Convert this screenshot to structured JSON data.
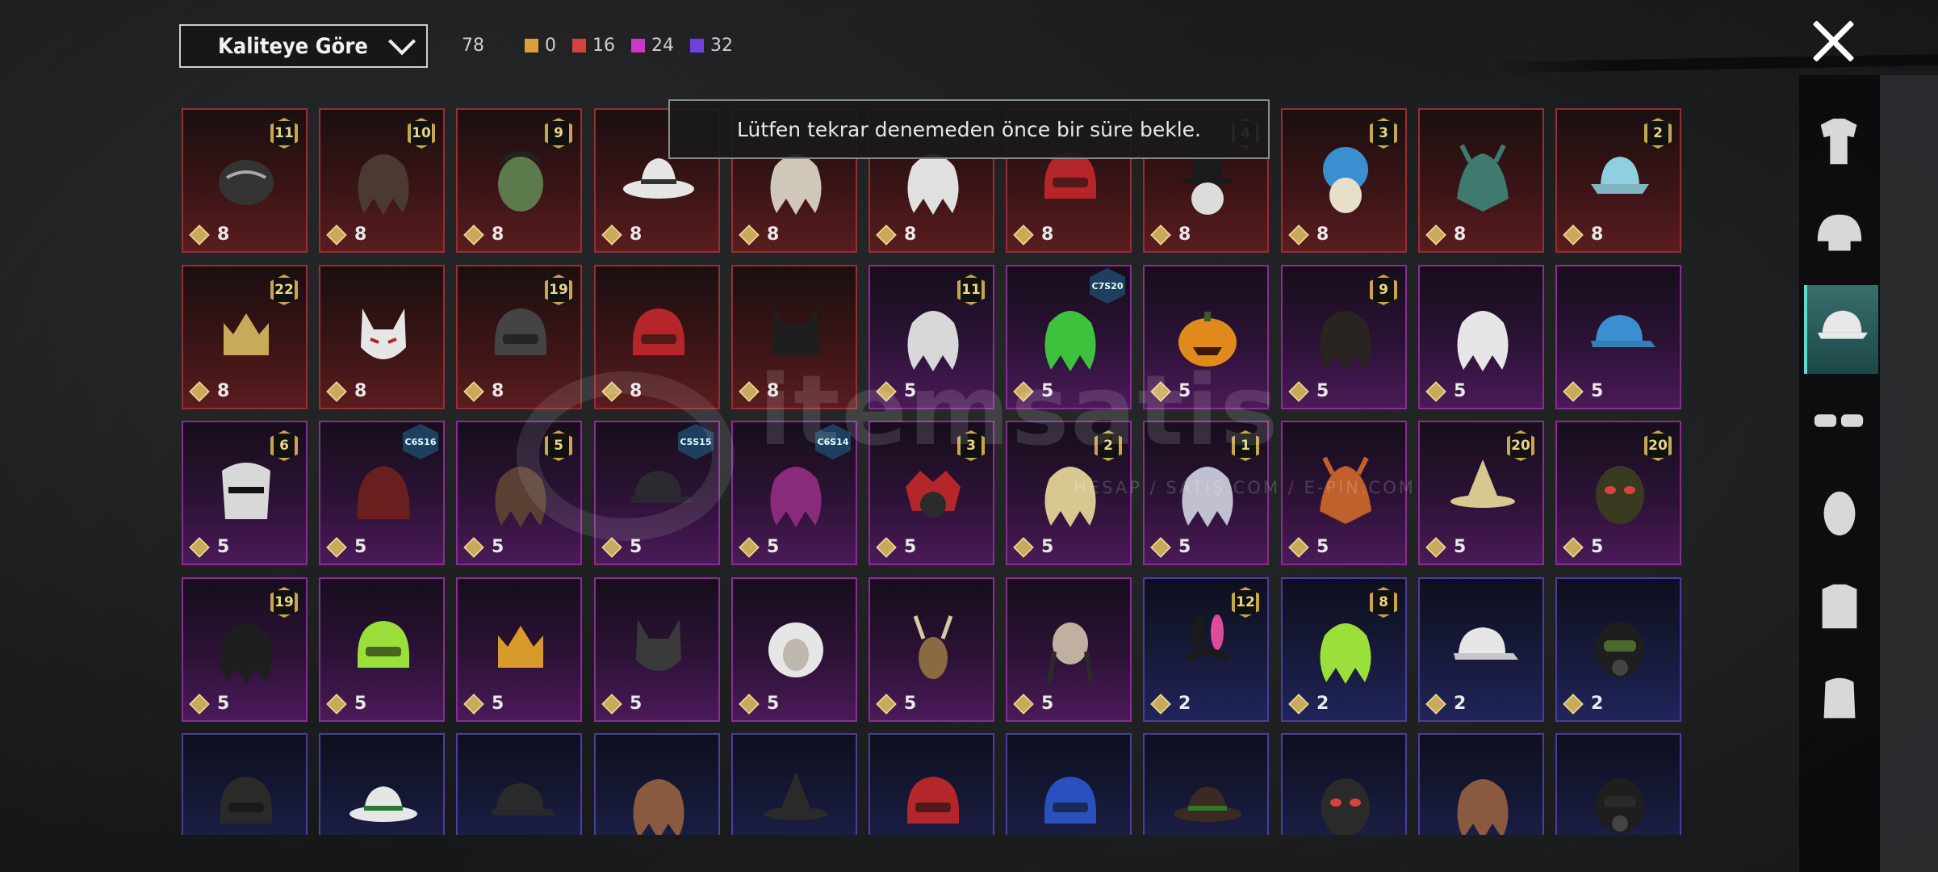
{
  "header": {
    "sort_label": "Kaliteye Göre",
    "total": "78",
    "counts": [
      {
        "color": "#d9a03b",
        "value": "0"
      },
      {
        "color": "#d6423e",
        "value": "16"
      },
      {
        "color": "#c83ac6",
        "value": "24"
      },
      {
        "color": "#6f3fe0",
        "value": "32"
      }
    ]
  },
  "toast": {
    "message": "Lütfen tekrar denemeden önce bir süre bekle."
  },
  "watermark": {
    "brand": "itemsatis",
    "sub": "HESAP / SATIŞ.COM / E-PIN.COM"
  },
  "categories": [
    {
      "name": "outfit-icon",
      "active": false
    },
    {
      "name": "helmet-icon",
      "active": false
    },
    {
      "name": "cap-icon",
      "active": true
    },
    {
      "name": "goggles-icon",
      "active": false
    },
    {
      "name": "mask-icon",
      "active": false
    },
    {
      "name": "jacket-icon",
      "active": false
    },
    {
      "name": "face-icon",
      "active": false
    }
  ],
  "items": [
    {
      "rarity": "red",
      "badge": "11",
      "price": "8",
      "art": "dark-hat",
      "color": "#333"
    },
    {
      "rarity": "red",
      "badge": "10",
      "price": "8",
      "art": "hair",
      "color": "#4a3a32"
    },
    {
      "rarity": "red",
      "badge": "9",
      "price": "8",
      "art": "zombie-head",
      "color": "#5c7a4c"
    },
    {
      "rarity": "red",
      "badge": "",
      "price": "8",
      "art": "cowboy-hat",
      "color": "#e6e6e6"
    },
    {
      "rarity": "red",
      "badge": "",
      "price": "8",
      "art": "hair",
      "color": "#cfc8b8"
    },
    {
      "rarity": "red",
      "badge": "",
      "price": "8",
      "art": "hair",
      "color": "#e0e0e0"
    },
    {
      "rarity": "red",
      "badge": "",
      "price": "8",
      "art": "helmet",
      "color": "#b5262a"
    },
    {
      "rarity": "red",
      "badge": "4",
      "price": "8",
      "art": "top-hat",
      "color": "#dcdcdc"
    },
    {
      "rarity": "red",
      "badge": "3",
      "price": "8",
      "art": "clown",
      "color": "#3a8fd0"
    },
    {
      "rarity": "red",
      "badge": "",
      "price": "8",
      "art": "dragon",
      "color": "#3f7a6e"
    },
    {
      "rarity": "red",
      "badge": "2",
      "price": "8",
      "art": "bucket-hat",
      "color": "#8fd0e0"
    },
    {
      "rarity": "red",
      "badge": "22",
      "price": "8",
      "art": "crown",
      "color": "#c9a95a"
    },
    {
      "rarity": "red",
      "badge": "",
      "price": "8",
      "art": "fox-mask",
      "color": "#e6e6e6"
    },
    {
      "rarity": "red",
      "badge": "19",
      "price": "8",
      "art": "helmet",
      "color": "#444"
    },
    {
      "rarity": "red",
      "badge": "",
      "price": "8",
      "art": "helmet",
      "color": "#b5262a"
    },
    {
      "rarity": "red",
      "badge": "",
      "price": "8",
      "art": "bat-helmet",
      "color": "#1e1e1e"
    },
    {
      "rarity": "purple",
      "badge": "11",
      "price": "5",
      "art": "hair",
      "color": "#d8d8d8"
    },
    {
      "rarity": "purple",
      "badge": "",
      "season": "C7S20",
      "price": "5",
      "art": "hair",
      "color": "#3ec23e"
    },
    {
      "rarity": "purple",
      "badge": "",
      "price": "5",
      "art": "pumpkin",
      "color": "#e08a1c"
    },
    {
      "rarity": "purple",
      "badge": "9",
      "price": "5",
      "art": "hair",
      "color": "#2a2420"
    },
    {
      "rarity": "purple",
      "badge": "",
      "price": "5",
      "art": "hair",
      "color": "#e6e6e6"
    },
    {
      "rarity": "purple",
      "badge": "",
      "price": "5",
      "art": "cap",
      "color": "#3a8fd0"
    },
    {
      "rarity": "purple",
      "badge": "6",
      "price": "5",
      "art": "knight-helmet",
      "color": "#d8d8d8"
    },
    {
      "rarity": "purple",
      "badge": "",
      "season": "C6S16",
      "price": "5",
      "art": "hood",
      "color": "#6a1f1f"
    },
    {
      "rarity": "purple",
      "badge": "5",
      "price": "5",
      "art": "hair",
      "color": "#5a4032"
    },
    {
      "rarity": "purple",
      "badge": "",
      "season": "C5S15",
      "price": "5",
      "art": "cap",
      "color": "#2a2a30"
    },
    {
      "rarity": "purple",
      "badge": "",
      "season": "C6S14",
      "price": "5",
      "art": "hair",
      "color": "#8a2a7a"
    },
    {
      "rarity": "purple",
      "badge": "3",
      "price": "5",
      "art": "jester",
      "color": "#b5262a"
    },
    {
      "rarity": "purple",
      "badge": "2",
      "price": "5",
      "art": "hair",
      "color": "#d8c890"
    },
    {
      "rarity": "purple",
      "badge": "1",
      "price": "5",
      "art": "hair",
      "color": "#c0c0d0"
    },
    {
      "rarity": "purple",
      "badge": "",
      "price": "5",
      "art": "dragon",
      "color": "#c0602a"
    },
    {
      "rarity": "purple",
      "badge": "20",
      "price": "5",
      "art": "witch-hat",
      "color": "#d8c890"
    },
    {
      "rarity": "purple",
      "badge": "20",
      "price": "5",
      "art": "mask",
      "color": "#3a3a20"
    },
    {
      "rarity": "purple",
      "badge": "19",
      "price": "5",
      "art": "hair",
      "color": "#1e1e1e"
    },
    {
      "rarity": "purple",
      "badge": "",
      "price": "5",
      "art": "helmet",
      "color": "#9be03a"
    },
    {
      "rarity": "purple",
      "badge": "",
      "price": "5",
      "art": "crown",
      "color": "#d89a2a"
    },
    {
      "rarity": "purple",
      "badge": "",
      "price": "5",
      "art": "cat-mask",
      "color": "#3a3a3a"
    },
    {
      "rarity": "purple",
      "badge": "",
      "price": "5",
      "art": "lion",
      "color": "#e6e6e6"
    },
    {
      "rarity": "purple",
      "badge": "",
      "price": "5",
      "art": "deer",
      "color": "#8a6a40"
    },
    {
      "rarity": "purple",
      "badge": "",
      "price": "5",
      "art": "skull",
      "color": "#c0b0a0"
    },
    {
      "rarity": "blue",
      "badge": "12",
      "price": "2",
      "art": "bunny-ears",
      "color": "#e04a9a"
    },
    {
      "rarity": "blue",
      "badge": "8",
      "price": "2",
      "art": "hair",
      "color": "#9be03a"
    },
    {
      "rarity": "blue",
      "badge": "",
      "price": "2",
      "art": "cap",
      "color": "#e6e6e6"
    },
    {
      "rarity": "blue",
      "badge": "",
      "price": "2",
      "art": "gas-mask",
      "color": "#4a6a30"
    },
    {
      "rarity": "blue",
      "badge": "",
      "price": "",
      "art": "helmet",
      "color": "#2a2a2a"
    },
    {
      "rarity": "blue",
      "badge": "",
      "price": "",
      "art": "fedora",
      "color": "#e6e6e6"
    },
    {
      "rarity": "blue",
      "badge": "",
      "price": "",
      "art": "cap",
      "color": "#2a2a2a"
    },
    {
      "rarity": "blue",
      "badge": "",
      "price": "",
      "art": "hair",
      "color": "#8a5a40"
    },
    {
      "rarity": "blue",
      "badge": "",
      "price": "",
      "art": "witch-hat",
      "color": "#2a2a2a"
    },
    {
      "rarity": "blue",
      "badge": "",
      "price": "",
      "art": "helmet",
      "color": "#b5262a"
    },
    {
      "rarity": "blue",
      "badge": "",
      "price": "",
      "art": "helmet",
      "color": "#2a50c0"
    },
    {
      "rarity": "blue",
      "badge": "",
      "price": "",
      "art": "fedora",
      "color": "#3a2a20"
    },
    {
      "rarity": "blue",
      "badge": "",
      "price": "",
      "art": "mask",
      "color": "#2a2a2a"
    },
    {
      "rarity": "blue",
      "badge": "",
      "price": "",
      "art": "hair",
      "color": "#8a5a40"
    },
    {
      "rarity": "blue",
      "badge": "",
      "price": "",
      "art": "gas-mask",
      "color": "#2a2a2a"
    }
  ]
}
